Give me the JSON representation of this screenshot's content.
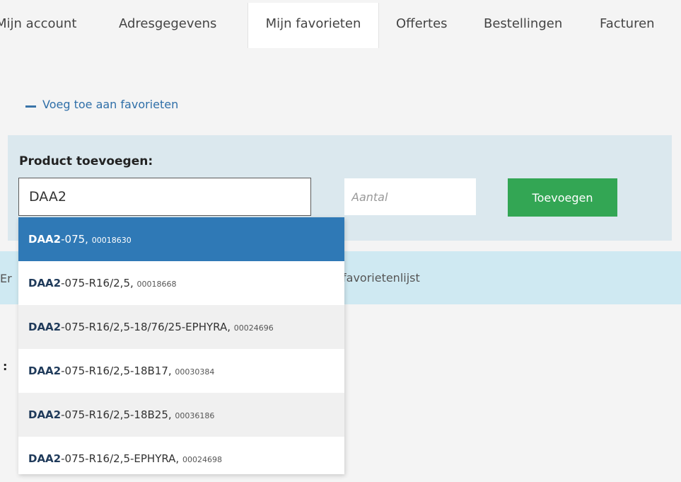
{
  "tabs": [
    {
      "label": "Mijn account"
    },
    {
      "label": "Adresgegevens"
    },
    {
      "label": "Mijn favorieten",
      "active": true
    },
    {
      "label": "Offertes"
    },
    {
      "label": "Bestellingen"
    },
    {
      "label": "Facturen"
    }
  ],
  "favorites": {
    "toggle_label": "Voeg toe aan favorieten",
    "panel_title": "Product toevoegen:",
    "search_value": "DAA2",
    "qty_placeholder": "Aantal",
    "add_button": "Toevoegen"
  },
  "info": {
    "prefix": "Er",
    "text": "favorietenlijst"
  },
  "edge_glyph": ":",
  "dropdown": {
    "items": [
      {
        "highlight": "DAA2",
        "rest": "-075, ",
        "code": "00018630",
        "selected": true
      },
      {
        "highlight": "DAA2",
        "rest": "-075-R16/2,5, ",
        "code": "00018668"
      },
      {
        "highlight": "DAA2",
        "rest": "-075-R16/2,5-18/76/25-EPHYRA, ",
        "code": "00024696"
      },
      {
        "highlight": "DAA2",
        "rest": "-075-R16/2,5-18B17, ",
        "code": "00030384"
      },
      {
        "highlight": "DAA2",
        "rest": "-075-R16/2,5-18B25, ",
        "code": "00036186"
      },
      {
        "highlight": "DAA2",
        "rest": "-075-R16/2,5-EPHYRA, ",
        "code": "00024698"
      }
    ]
  },
  "colors": {
    "accent_blue": "#2f79b6",
    "button_green": "#33a654",
    "panel_bg": "#dbe8ee",
    "info_bg": "#cfe9f2"
  }
}
